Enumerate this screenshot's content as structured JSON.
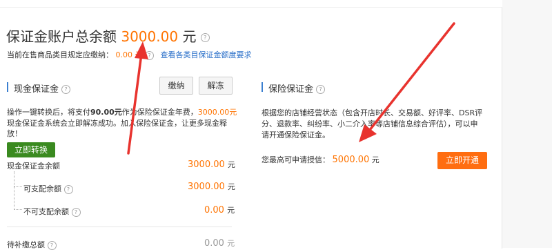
{
  "header": {
    "title": "保证金账户总余额",
    "amount": "3000.00",
    "unit": "元",
    "help_icon": "?"
  },
  "subheader": {
    "text": "当前在售商品类目规定应缴纳：",
    "value": "0.00 元",
    "link": "查看各类目保证金额度要求"
  },
  "cash": {
    "title": "现金保证金",
    "pay_label": "缴纳",
    "unfreeze_label": "解冻",
    "desc_1a": "操作一键转换后，将支付",
    "desc_1b": "90.00元",
    "desc_1c": "作为保险保证金年费，",
    "desc_1d": "3000.00元",
    "desc_2": "现金保证金系统会立即解冻成功。加入保险保证金，让更多现金释",
    "desc_3": "放！",
    "convert_label": "立即转换",
    "rows": [
      {
        "label": "现金保证金余额",
        "value": "3000.00",
        "unit": "元"
      },
      {
        "label": "可支配余额",
        "value": "3000.00",
        "unit": "元"
      },
      {
        "label": "不可支配余额",
        "value": "0.00",
        "unit": "元"
      },
      {
        "label": "待补缴总额",
        "value": "0.00",
        "unit": "元"
      }
    ]
  },
  "insurance": {
    "title": "保险保证金",
    "desc_1": "根据您的店铺经营状态（包含开店时长、交易额、好评率、DSR评",
    "desc_2": "分、退款率、纠纷率、小二介入率等店铺信息综合评估），可以申",
    "desc_3": "请开通保险保证金。",
    "credit_label": "您最高可申请授信：",
    "credit_value": "5000.00",
    "credit_unit": "元",
    "open_label": "立即开通"
  },
  "colors": {
    "accent_orange": "#ff7300",
    "arrow_red": "#e8332e",
    "green_button": "#3a8a20",
    "link_blue": "#2a6fc9"
  }
}
